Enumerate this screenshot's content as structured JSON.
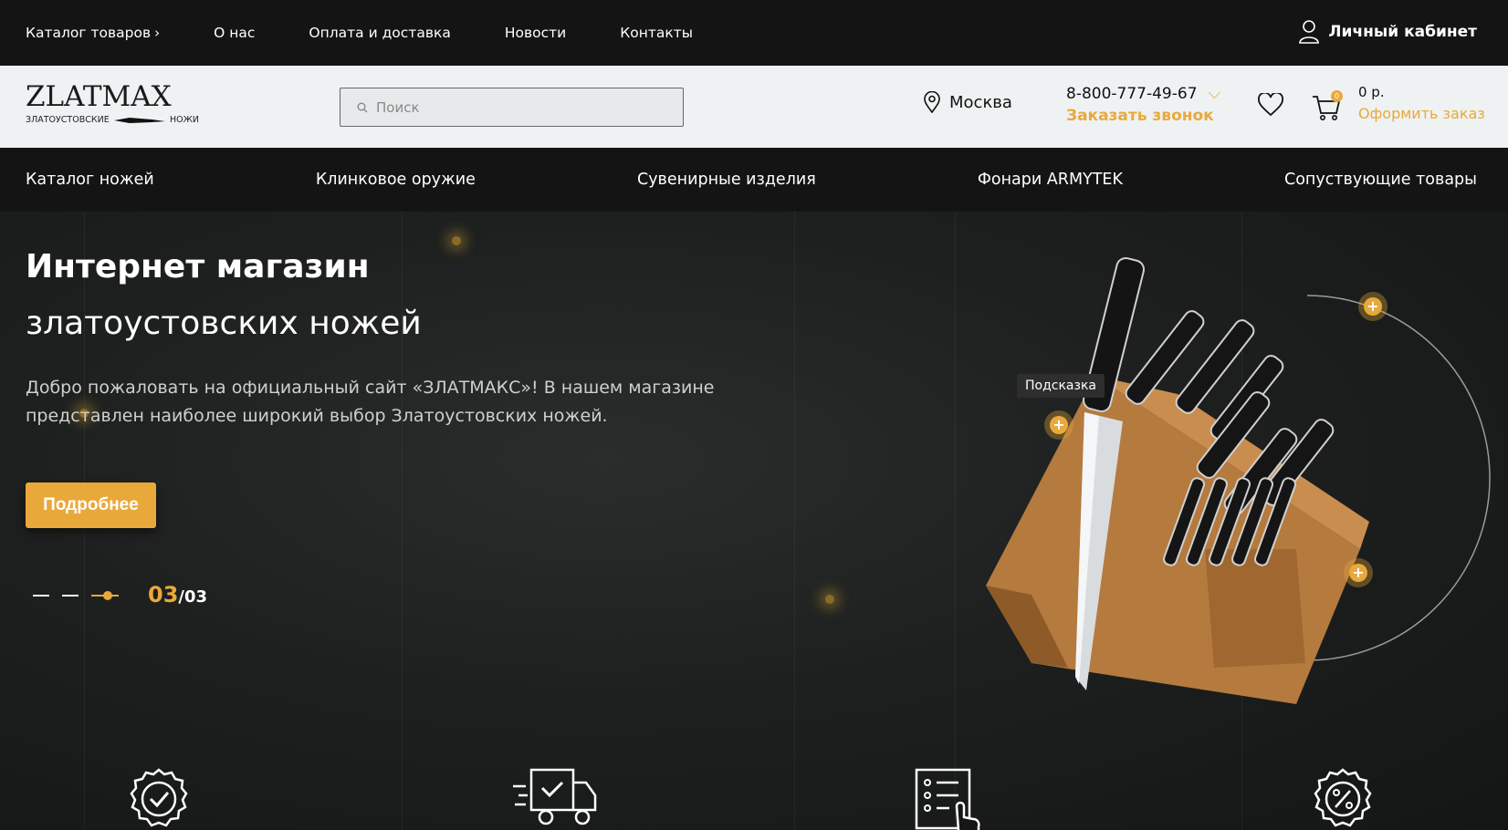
{
  "topbar": {
    "nav": [
      {
        "label": "Каталог товаров",
        "chevron": "›"
      },
      {
        "label": "О нас"
      },
      {
        "label": "Оплата и доставка"
      },
      {
        "label": "Новости"
      },
      {
        "label": "Контакты"
      }
    ],
    "account_label": "Личный кабинет"
  },
  "header": {
    "logo_main": "ZLATMAX",
    "logo_sub_left": "ЗЛАТОУСТОВСКИЕ",
    "logo_sub_right": "НОЖИ",
    "search_placeholder": "Поиск",
    "city": "Москва",
    "phone": "8-800-777-49-67",
    "callback_label": "Заказать звонок",
    "cart_count": "0",
    "cart_sum": "0 р.",
    "checkout_label": "Оформить заказ"
  },
  "mainnav": [
    "Каталог ножей",
    "Клинковое оружие",
    "Сувенирные изделия",
    "Фонари ARMYTEK",
    "Сопуствующие товары"
  ],
  "hero": {
    "title_bold": "Интернет магазин",
    "title_regular": "златоустовских ножей",
    "description": "Добро пожаловать на официальный сайт «ЗЛАТМАКС»! В нашем магазине представлен наиболее широкий выбор Златоустовских ножей.",
    "button_label": "Подробнее",
    "slide_current": "03",
    "slide_total": "/03",
    "tooltip": "Подсказка",
    "hotspot_symbol": "+"
  },
  "colors": {
    "accent": "#e9a93a",
    "dark": "#141414",
    "header_bg": "#eef2f2"
  },
  "features_icons": [
    "quality-badge-icon",
    "delivery-truck-icon",
    "checklist-icon",
    "discount-badge-icon"
  ]
}
